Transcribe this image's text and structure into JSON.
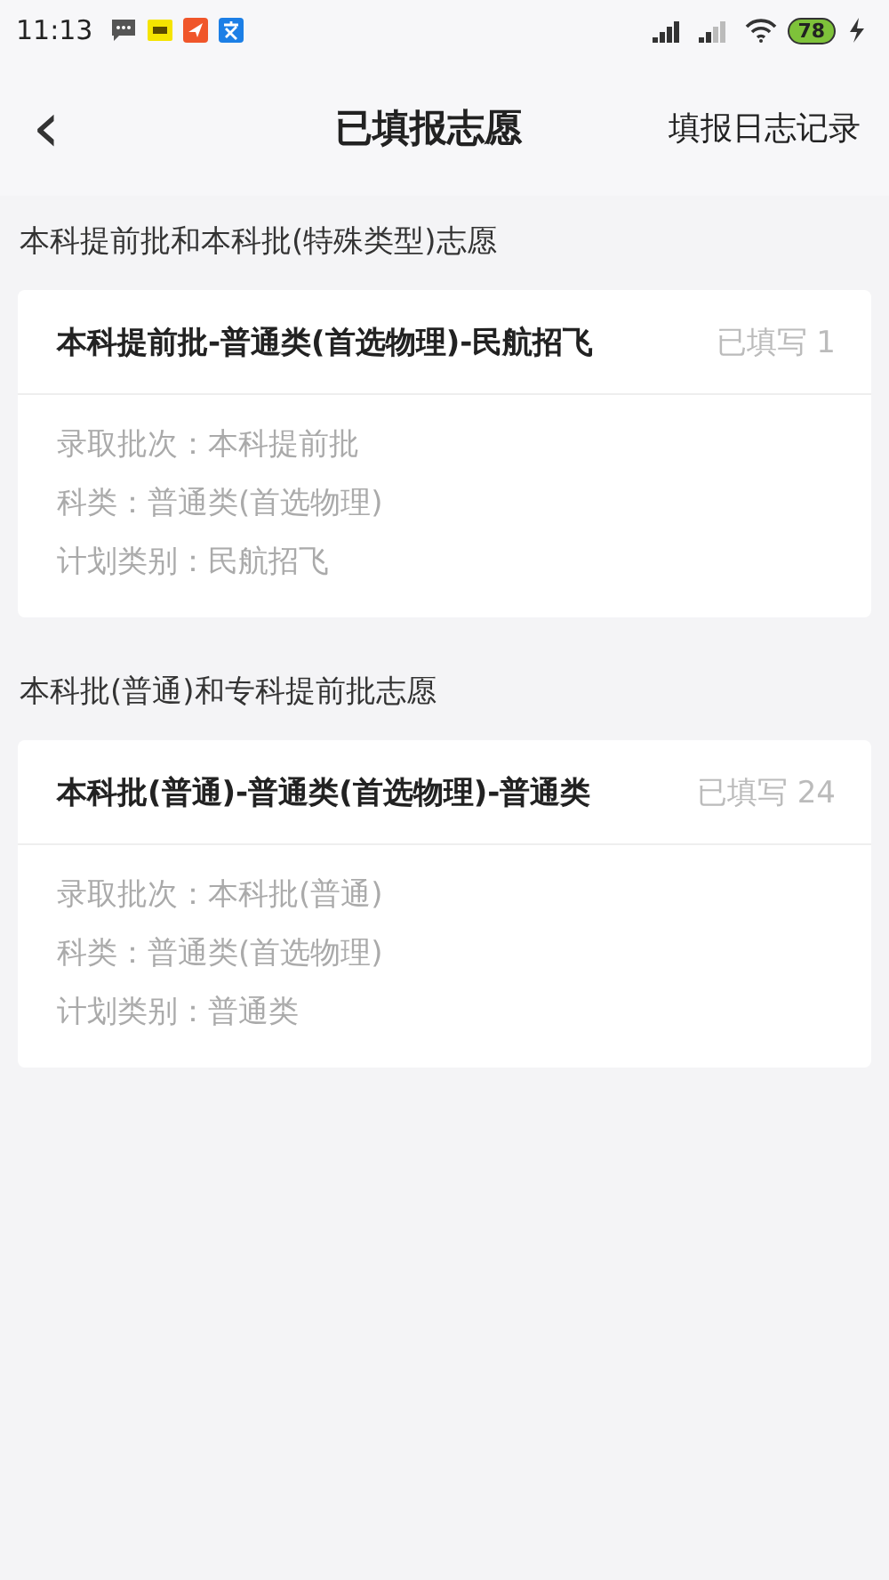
{
  "status_bar": {
    "time": "11:13",
    "battery": "78"
  },
  "header": {
    "back": "‹",
    "title": "已填报志愿",
    "action": "填报日志记录"
  },
  "sections": [
    {
      "title": "本科提前批和本科批(特殊类型)志愿",
      "cards": [
        {
          "name": "本科提前批-普通类(首选物理)-民航招飞",
          "count": "已填写 1",
          "details": [
            "录取批次：本科提前批",
            "科类：普通类(首选物理)",
            "计划类别：民航招飞"
          ]
        }
      ]
    },
    {
      "title": "本科批(普通)和专科提前批志愿",
      "cards": [
        {
          "name": "本科批(普通)-普通类(首选物理)-普通类",
          "count": "已填写 24",
          "details": [
            "录取批次：本科批(普通)",
            "科类：普通类(首选物理)",
            "计划类别：普通类"
          ]
        }
      ]
    }
  ]
}
